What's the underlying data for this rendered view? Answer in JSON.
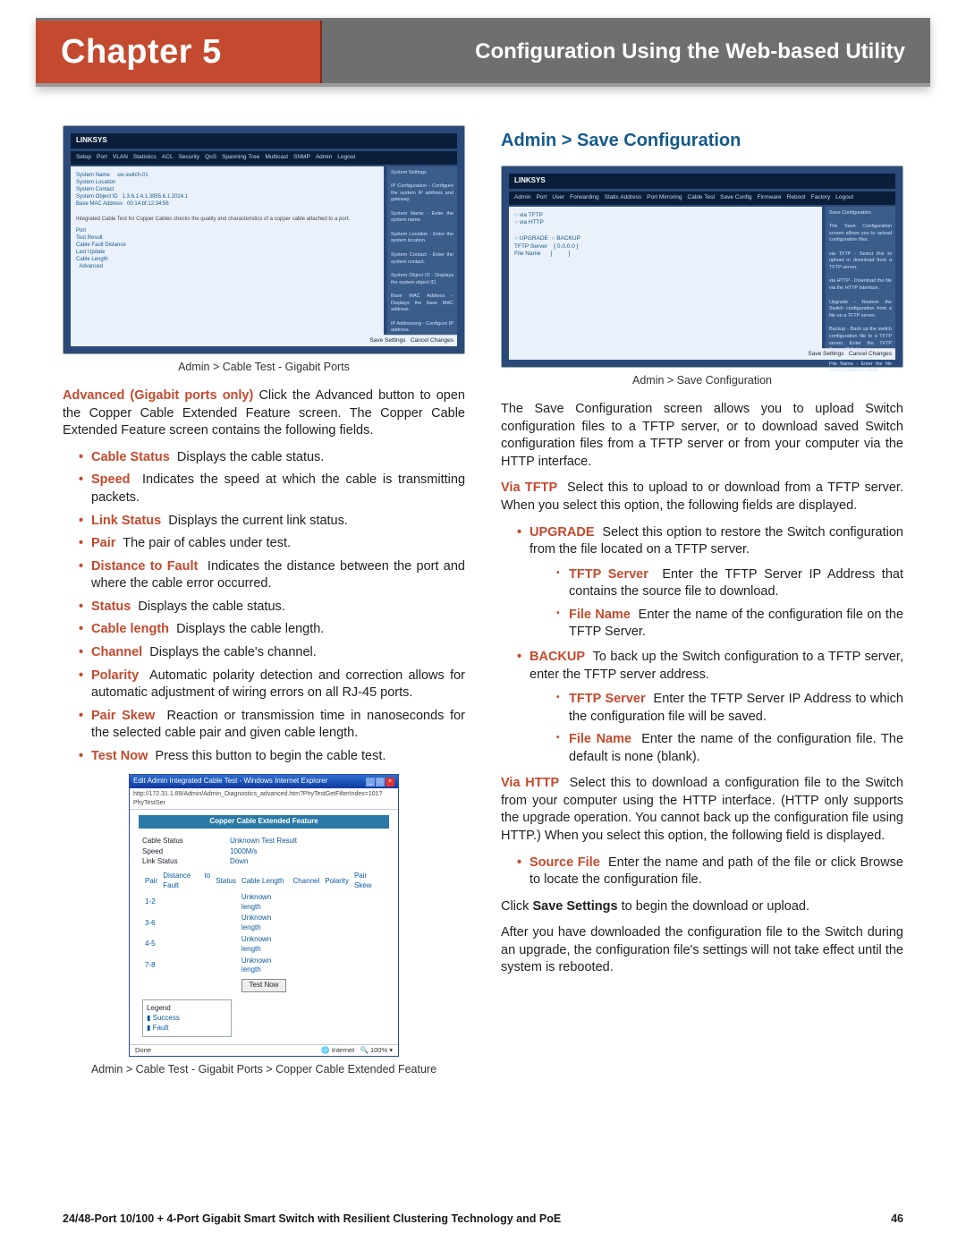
{
  "header": {
    "chapter": "Chapter 5",
    "title": "Configuration Using the Web-based Utility"
  },
  "left": {
    "fig1_caption": "Admin > Cable Test - Gigabit Ports",
    "adv_label": "Advanced (Gigabit ports only)",
    "adv_text": "Click the Advanced button to open the Copper Cable Extended Feature screen. The Copper Cable Extended Feature screen contains the following fields.",
    "items": [
      {
        "name": "Cable Status",
        "desc": "Displays the cable status."
      },
      {
        "name": "Speed",
        "desc": "Indicates the speed at which the cable is transmitting packets."
      },
      {
        "name": "Link Status",
        "desc": "Displays the current link status."
      },
      {
        "name": "Pair",
        "desc": "The pair of cables under test."
      },
      {
        "name": "Distance to Fault",
        "desc": "Indicates the distance between the port and where the cable error occurred."
      },
      {
        "name": "Status",
        "desc": "Displays the cable status."
      },
      {
        "name": "Cable length",
        "desc": "Displays the cable length."
      },
      {
        "name": "Channel",
        "desc": "Displays the cable's channel."
      },
      {
        "name": "Polarity",
        "desc": "Automatic polarity detection and correction allows for automatic adjustment of wiring errors on all RJ-45 ports."
      },
      {
        "name": "Pair Skew",
        "desc": "Reaction or transmission time in nanoseconds for the selected cable pair and given cable length."
      },
      {
        "name": "Test Now",
        "desc": "Press this button to begin the cable test."
      }
    ],
    "fig2_caption": "Admin > Cable Test - Gigabit Ports > Copper Cable Extended Feature",
    "browser": {
      "title": "Edit Admin Integrated Cable Test - Windows Internet Explorer",
      "url": "http://172.31.1.89/Admin/Admin_Diagnostics_advanced.htm?PhyTestGetFilterIndex=101?PhyTestSer",
      "banner": "Copper Cable Extended Feature",
      "cableStatusLabel": "Cable Status",
      "cableStatusValue": "Unknown Test Result",
      "speedLabel": "Speed",
      "speedValue": "1000M/s",
      "linkStatusLabel": "Link Status",
      "linkStatusValue": "Down",
      "headers": [
        "Pair",
        "Distance to Fault",
        "Status",
        "Cable Length",
        "Channel",
        "Polarity",
        "Pair Skew"
      ],
      "rows": [
        {
          "pair": "1-2",
          "len": "Unknown length"
        },
        {
          "pair": "3-6",
          "len": "Unknown length"
        },
        {
          "pair": "4-5",
          "len": "Unknown length"
        },
        {
          "pair": "7-8",
          "len": "Unknown length"
        }
      ],
      "testNow": "Test Now",
      "legendTitle": "Legend",
      "legendItems": [
        "Success",
        "Fault"
      ],
      "statusDone": "Done",
      "statusZone": "Internet",
      "statusZoom": "100%"
    }
  },
  "right": {
    "heading": "Admin > Save Configuration",
    "fig_caption": "Admin > Save Configuration",
    "p1": "The Save Configuration screen allows you to upload Switch configuration files to a TFTP server, or to download saved Switch configuration files from a TFTP server or from your computer via the HTTP interface.",
    "viaTftp_label": "Via TFTP",
    "viaTftp_text": "Select this to upload to or download from a TFTP server. When you select this option, the following fields are displayed.",
    "upgrade_label": "UPGRADE",
    "upgrade_text": "Select this option to restore the Switch configuration from the file located on a TFTP server.",
    "upgrade_sub": [
      {
        "name": "TFTP Server",
        "desc": "Enter the TFTP Server IP Address that contains the source file to download."
      },
      {
        "name": "File Name",
        "desc": "Enter the name of the configuration file on the TFTP Server."
      }
    ],
    "backup_label": "BACKUP",
    "backup_text": "To back up the Switch configuration to a TFTP server, enter the TFTP server address.",
    "backup_sub": [
      {
        "name": "TFTP Server",
        "desc": "Enter the TFTP Server IP Address to which the configuration file will be saved."
      },
      {
        "name": "File Name",
        "desc": "Enter the name of the configuration file. The default is none (blank)."
      }
    ],
    "viaHttp_label": "Via HTTP",
    "viaHttp_text": "Select this to download a configuration file to the Switch from your computer using the HTTP interface. (HTTP only supports the upgrade operation. You cannot back up the configuration file using HTTP.) When you select this option, the following field is displayed.",
    "sourceFile_label": "Source File",
    "sourceFile_text": "Enter the name and path of the file or click Browse to locate the configuration file.",
    "p2a": "Click ",
    "p2_bold": "Save Settings",
    "p2b": " to begin the download or upload.",
    "p3": "After you have downloaded the configuration file to the Switch during an upgrade, the configuration file's settings will not take effect until the system is rebooted."
  },
  "footer": {
    "product": "24/48-Port 10/100 + 4-Port Gigabit Smart Switch with Resilient Clustering Technology and PoE",
    "page": "46"
  },
  "screenshot_common": {
    "logo": "LINKSYS",
    "save_btn": "Save Settings",
    "cancel_btn": "Cancel Changes"
  }
}
